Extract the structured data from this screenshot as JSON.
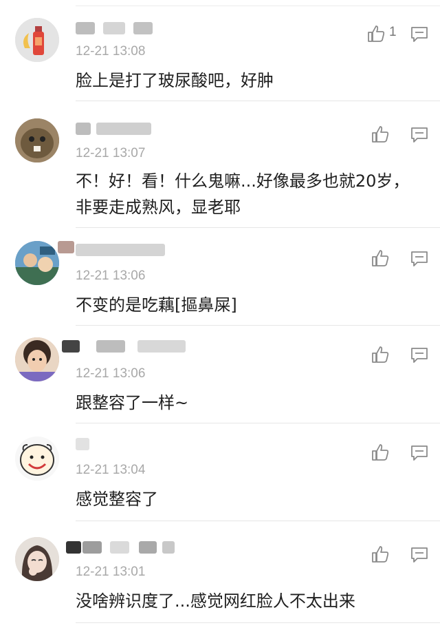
{
  "comments": [
    {
      "time": "12-21 13:08",
      "text": "脸上是打了玻尿酸吧，好肿",
      "likes": "1",
      "avatar_icon": "juice-bottle-avatar"
    },
    {
      "time": "12-21 13:07",
      "text": "不！好！看！什么鬼嘛...好像最多也就20岁，非要走成熟风，显老耶",
      "likes": "",
      "avatar_icon": "bird-avatar"
    },
    {
      "time": "12-21 13:06",
      "text": "不变的是吃藕[摳鼻屎]",
      "likes": "",
      "avatar_icon": "people-avatar"
    },
    {
      "time": "12-21 13:06",
      "text": "跟整容了一样~",
      "likes": "",
      "avatar_icon": "girl-avatar"
    },
    {
      "time": "12-21 13:04",
      "text": "感觉整容了",
      "likes": "",
      "avatar_icon": "smiley-avatar"
    },
    {
      "time": "12-21 13:01",
      "text": "没啥辨识度了...感觉网红脸人不太出来",
      "likes": "",
      "avatar_icon": "anime-avatar"
    }
  ],
  "colors": {
    "time": "#a8a8a8",
    "icon": "#8a8a8a",
    "divider": "#e6e6e6"
  }
}
